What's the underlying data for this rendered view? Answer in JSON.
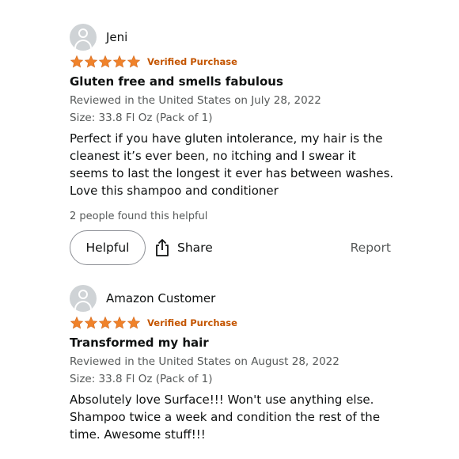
{
  "colors": {
    "star": "#f0822a",
    "verified": "#c45500",
    "meta": "#565959",
    "text": "#0f1111",
    "avatar": "#cfd3d6"
  },
  "reviews": [
    {
      "reviewer": "Jeni",
      "avatar_icon": "user-avatar-icon",
      "stars": 5,
      "verified": "Verified Purchase",
      "title": "Gluten free and smells fabulous",
      "reviewed": "Reviewed in the United States on July 28, 2022",
      "size": "Size: 33.8 Fl Oz (Pack of 1)",
      "body": "Perfect if you have gluten intolerance, my hair is the cleanest it’s ever been, no itching and I swear it seems to last the longest it ever has between washes. Love this shampoo and conditioner",
      "helpful_count": "2 people found this helpful",
      "helpful_label": "Helpful",
      "share_label": "Share",
      "share_icon": "share-icon",
      "report_label": "Report"
    },
    {
      "reviewer": "Amazon Customer",
      "avatar_icon": "user-avatar-icon",
      "stars": 5,
      "verified": "Verified Purchase",
      "title": "Transformed my hair",
      "reviewed": "Reviewed in the United States on August 28, 2022",
      "size": "Size: 33.8 Fl Oz (Pack of 1)",
      "body": "Absolutely love Surface!!! Won't use anything else. Shampoo twice a week and condition the rest of the time. Awesome stuff!!!"
    }
  ]
}
